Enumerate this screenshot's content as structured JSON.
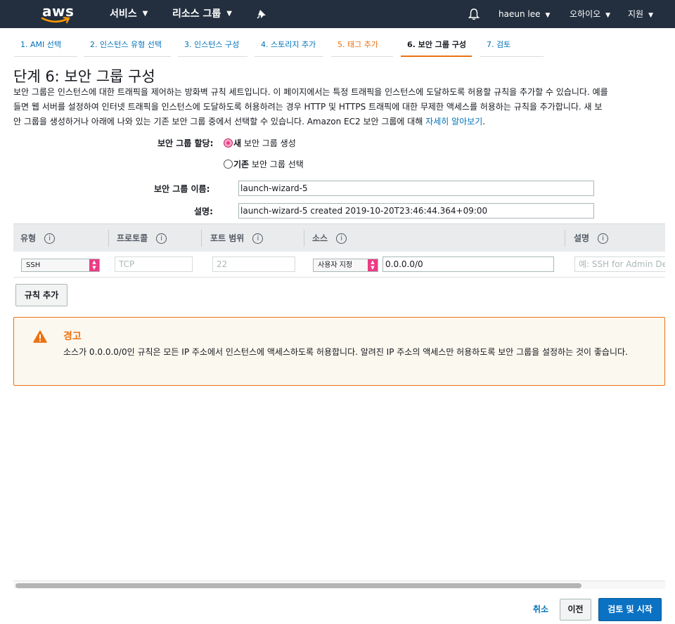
{
  "nav": {
    "logo_text": "aws",
    "services": "서비스",
    "resource_groups": "리소스 그룹",
    "pin_icon": "pushpin-icon",
    "bell_icon": "bell-icon",
    "user": "haeun lee",
    "region": "오하이오",
    "support": "지원"
  },
  "steps": [
    {
      "label": "1. AMI 선택"
    },
    {
      "label": "2. 인스턴스 유형 선택"
    },
    {
      "label": "3. 인스턴스 구성"
    },
    {
      "label": "4. 스토리지 추가"
    },
    {
      "label": "5. 태그 추가"
    },
    {
      "label": "6. 보안 그룹 구성"
    },
    {
      "label": "7. 검토"
    }
  ],
  "page": {
    "title": "단계 6: 보안 그룹 구성",
    "desc_line1": "보안 그룹은 인스턴스에 대한 트래픽을 제어하는 방화벽 규칙 세트입니다. 이 페이지에서는 특정 트래픽을 인스턴스에 도달하도록 허용할 규칙을 추가할 수 있습니다. 예를",
    "desc_line2": "들면 웹 서버를 설정하여 인터넷 트래픽을 인스턴스에 도달하도록 허용하려는 경우 HTTP 및 HTTPS 트래픽에 대한 무제한 액세스를 허용하는 규칙을 추가합니다. 새 보",
    "desc_line3": "안 그룹을 생성하거나 아래에 나와 있는 기존 보안 그룹 중에서 선택할 수 있습니다. Amazon EC2 보안 그룹에 대해 ",
    "learn_more": "자세히 알아보기",
    "desc_end": "."
  },
  "form": {
    "assign_label": "보안 그룹 할당:",
    "new_bold": "새",
    "new_rest": " 보안 그룹 생성",
    "existing_bold": "기존",
    "existing_rest": " 보안 그룹 선택",
    "name_label": "보안 그룹 이름:",
    "name_value": "launch-wizard-5",
    "desc_label": "설명:",
    "desc_value": "launch-wizard-5 created 2019-10-20T23:46:44.364+09:00"
  },
  "table": {
    "headers": {
      "type": "유형",
      "protocol": "프로토콜",
      "port": "포트 범위",
      "source": "소스",
      "description": "설명"
    },
    "info_glyph": "i",
    "row": {
      "type": "SSH",
      "protocol": "TCP",
      "port": "22",
      "source_select": "사용자 지정",
      "source_cidr": "0.0.0.0/0",
      "description_placeholder": "예: SSH for Admin Desktop"
    }
  },
  "add_rule": "규칙 추가",
  "warning": {
    "title": "경고",
    "body": "소스가 0.0.0.0/0인 규칙은 모든 IP 주소에서 인스턴스에 액세스하도록 허용합니다. 알려진 IP 주소의 액세스만 허용하도록 보안 그룹을 설정하는 것이 좋습니다.",
    "icon": "warning-triangle-icon"
  },
  "footer": {
    "cancel": "취소",
    "previous": "이전",
    "review_launch": "검토 및 시작"
  },
  "colors": {
    "nav_bg": "#232f3e",
    "accent_orange": "#ec7211",
    "link_blue": "#0073bb",
    "primary_button": "#0b72c3"
  }
}
